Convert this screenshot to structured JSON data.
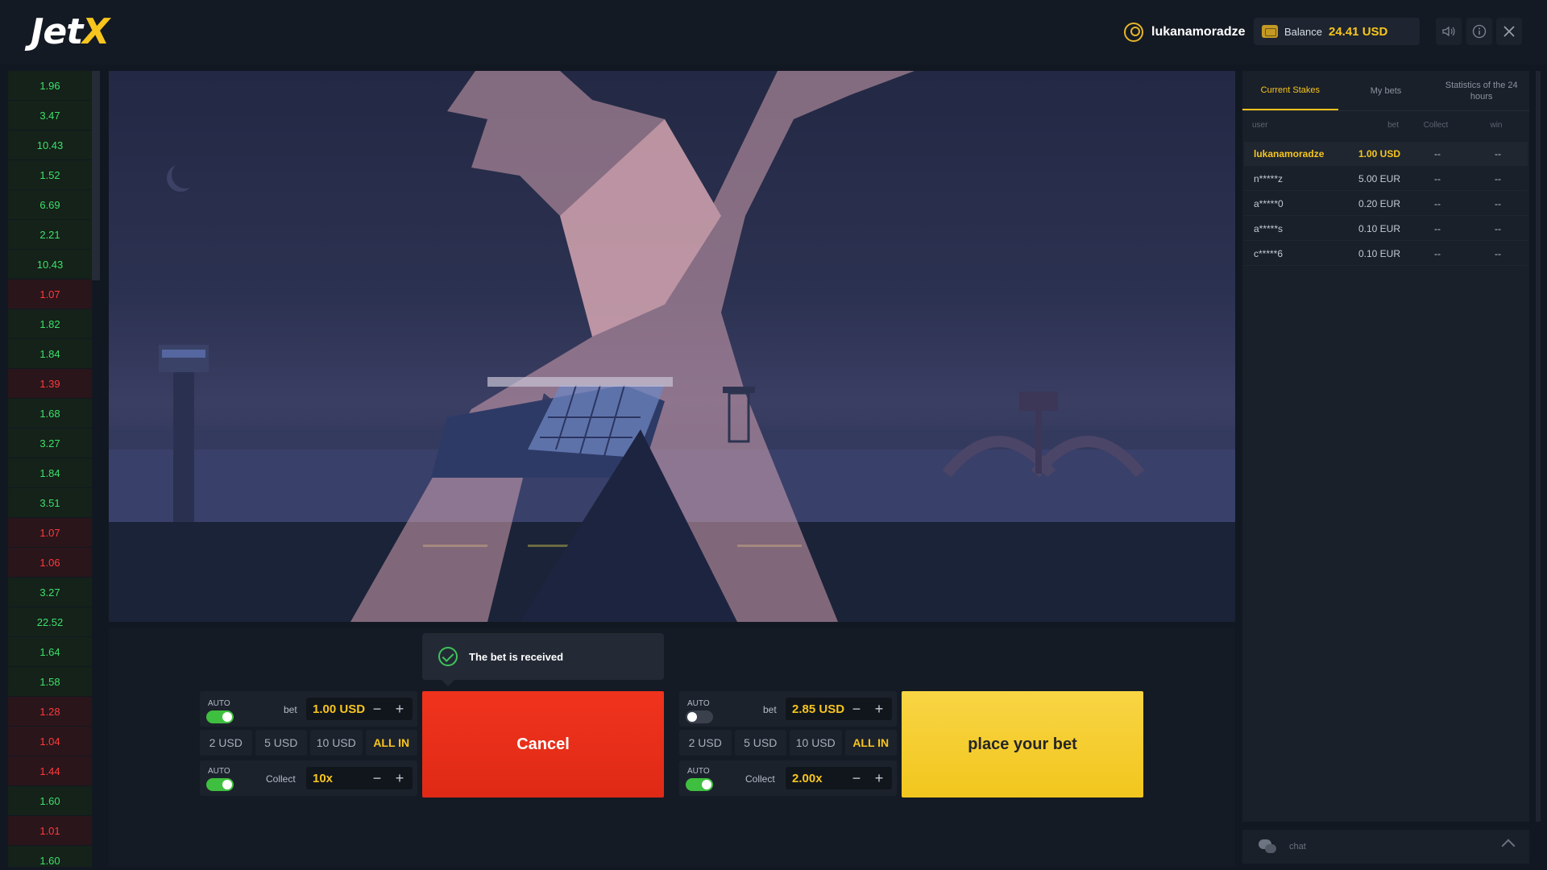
{
  "header": {
    "logo_main": "Jet",
    "logo_accent": "X",
    "username": "lukanamoradze",
    "balance_label": "Balance",
    "balance_value": "24.41 USD",
    "buttons": [
      "sound-icon",
      "info-icon",
      "close-icon"
    ]
  },
  "history": [
    {
      "v": "1.96",
      "c": "green"
    },
    {
      "v": "3.47",
      "c": "green"
    },
    {
      "v": "10.43",
      "c": "green"
    },
    {
      "v": "1.52",
      "c": "green"
    },
    {
      "v": "6.69",
      "c": "green"
    },
    {
      "v": "2.21",
      "c": "green"
    },
    {
      "v": "10.43",
      "c": "green"
    },
    {
      "v": "1.07",
      "c": "red"
    },
    {
      "v": "1.82",
      "c": "green"
    },
    {
      "v": "1.84",
      "c": "green"
    },
    {
      "v": "1.39",
      "c": "red"
    },
    {
      "v": "1.68",
      "c": "green"
    },
    {
      "v": "3.27",
      "c": "green"
    },
    {
      "v": "1.84",
      "c": "green"
    },
    {
      "v": "3.51",
      "c": "green"
    },
    {
      "v": "1.07",
      "c": "red"
    },
    {
      "v": "1.06",
      "c": "red"
    },
    {
      "v": "3.27",
      "c": "green"
    },
    {
      "v": "22.52",
      "c": "green"
    },
    {
      "v": "1.64",
      "c": "green"
    },
    {
      "v": "1.58",
      "c": "green"
    },
    {
      "v": "1.28",
      "c": "red"
    },
    {
      "v": "1.04",
      "c": "red"
    },
    {
      "v": "1.44",
      "c": "red"
    },
    {
      "v": "1.60",
      "c": "green"
    },
    {
      "v": "1.01",
      "c": "red"
    },
    {
      "v": "1.60",
      "c": "green"
    }
  ],
  "toast": {
    "text": "The bet is received"
  },
  "bet1": {
    "auto_label": "AUTO",
    "auto_bet_on": true,
    "bet_label": "bet",
    "bet_value": "1.00 USD",
    "quick": [
      "2 USD",
      "5 USD",
      "10 USD",
      "ALL IN"
    ],
    "collect_auto_label": "AUTO",
    "collect_auto_on": true,
    "collect_label": "Collect",
    "collect_value": "10x",
    "action_label": "Cancel"
  },
  "bet2": {
    "auto_label": "AUTO",
    "auto_bet_on": false,
    "bet_label": "bet",
    "bet_value": "2.85 USD",
    "quick": [
      "2 USD",
      "5 USD",
      "10 USD",
      "ALL IN"
    ],
    "collect_auto_label": "AUTO",
    "collect_auto_on": true,
    "collect_label": "Collect",
    "collect_value": "2.00x",
    "action_label": "place your bet"
  },
  "sidebar": {
    "tabs": [
      "Current Stakes",
      "My bets",
      "Statistics of the 24 hours"
    ],
    "active_tab": 0,
    "columns": [
      "user",
      "bet",
      "Collect",
      "win"
    ],
    "rows": [
      {
        "user": "lukanamoradze",
        "bet": "1.00 USD",
        "collect": "--",
        "win": "--",
        "mine": true
      },
      {
        "user": "n*****z",
        "bet": "5.00 EUR",
        "collect": "--",
        "win": "--",
        "mine": false
      },
      {
        "user": "a*****0",
        "bet": "0.20 EUR",
        "collect": "--",
        "win": "--",
        "mine": false
      },
      {
        "user": "a*****s",
        "bet": "0.10 EUR",
        "collect": "--",
        "win": "--",
        "mine": false
      },
      {
        "user": "c*****6",
        "bet": "0.10 EUR",
        "collect": "--",
        "win": "--",
        "mine": false
      }
    ],
    "chat_label": "chat"
  },
  "colors": {
    "accent": "#f7c51e",
    "win": "#3ee06a",
    "loss": "#ff3b3b",
    "cancel": "#e82e19",
    "place": "#f5cd2e"
  }
}
